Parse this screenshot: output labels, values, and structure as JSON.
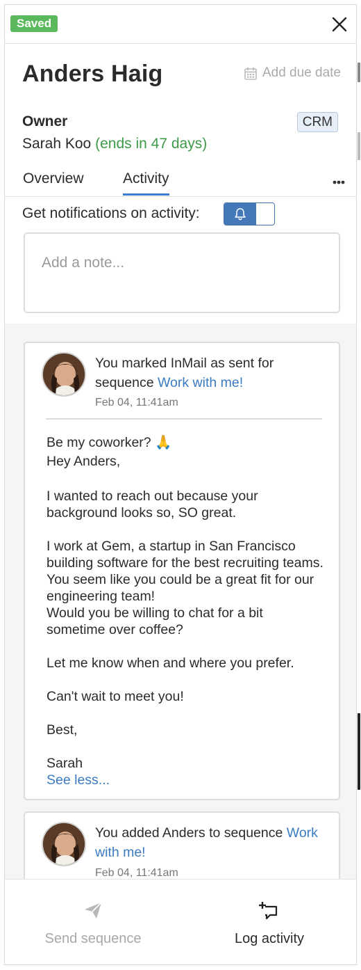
{
  "status_badge": "Saved",
  "contact": {
    "name": "Anders Haig",
    "due_date_label": "Add due date",
    "owner_label": "Owner",
    "owner_name": "Sarah Koo",
    "owner_ends": "(ends in 47 days)",
    "crm_badge": "CRM"
  },
  "tabs": [
    {
      "label": "Overview",
      "active": false
    },
    {
      "label": "Activity",
      "active": true
    }
  ],
  "notifications": {
    "label": "Get notifications on activity:",
    "enabled": true
  },
  "note": {
    "placeholder": "Add a note..."
  },
  "activity": [
    {
      "text_prefix": "You marked InMail as sent for sequence",
      "link": "Work with me!",
      "time": "Feb 04, 11:41am",
      "message": {
        "subject": "Be my coworker? 🙏",
        "greeting": "Hey Anders,",
        "p1": "I wanted to reach out because your background looks so, SO great.",
        "p2a": "I work at Gem, a startup in San Francisco building software for the best recruiting teams. You seem like you could be a great fit for our engineering team!",
        "p2b": "Would you be willing to chat for a bit sometime over coffee?",
        "p3": "Let me know when and where you prefer.",
        "p4": "Can't wait to meet you!",
        "signoff": "Best,",
        "signature": "Sarah"
      },
      "see_less": "See less..."
    },
    {
      "text_prefix": "You added Anders to sequence",
      "link": "Work with me!",
      "time": "Feb 04, 11:41am"
    }
  ],
  "footer": {
    "send_label": "Send sequence",
    "log_label": "Log activity"
  },
  "colors": {
    "saved_green": "#5cb85c",
    "accent_blue": "#3a7bd5",
    "link_blue": "#3a7bc2",
    "owner_green": "#3d9a48"
  }
}
